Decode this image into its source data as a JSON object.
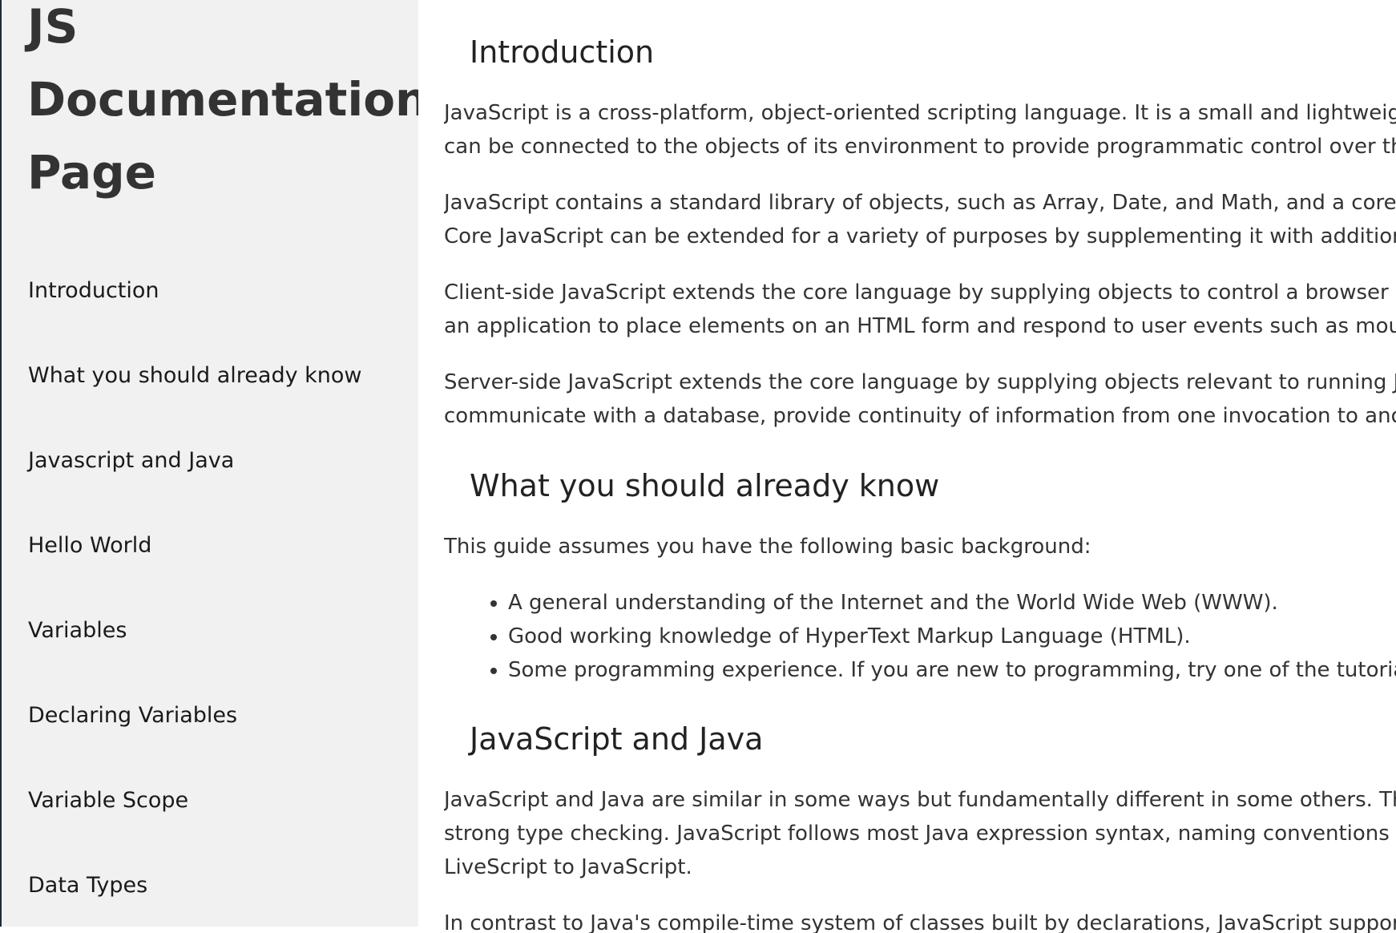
{
  "nav": {
    "title": "JS Documentation Page",
    "items": [
      "Introduction",
      "What you should already know",
      "Javascript and Java",
      "Hello World",
      "Variables",
      "Declaring Variables",
      "Variable Scope",
      "Data Types"
    ]
  },
  "main": {
    "intro": {
      "heading": "Introduction",
      "paragraphs": [
        "JavaScript is a cross-platform, object-oriented scripting language. It is a small and lightweig",
        "can be connected to the objects of its environment to provide programmatic control over the",
        "JavaScript contains a standard library of objects, such as Array, Date, and Math, and a core s",
        "Core JavaScript can be extended for a variety of purposes by supplementing it with additiona",
        "Client-side JavaScript extends the core language by supplying objects to control a browser a",
        "an application to place elements on an HTML form and respond to user events such as mous",
        "Server-side JavaScript extends the core language by supplying objects relevant to running J",
        "communicate with a database, provide continuity of information from one invocation to anoth"
      ]
    },
    "know": {
      "heading": "What you should already know",
      "lead": "This guide assumes you have the following basic background:",
      "bullets": [
        "A general understanding of the Internet and the World Wide Web (WWW).",
        "Good working knowledge of HyperText Markup Language (HTML).",
        "Some programming experience. If you are new to programming, try one of the tutorials"
      ]
    },
    "java": {
      "heading": "JavaScript and Java",
      "lines": [
        "JavaScript and Java are similar in some ways but fundamentally different in some others. The",
        "strong type checking. JavaScript follows most Java expression syntax, naming conventions a",
        "LiveScript to JavaScript.",
        "In contrast to Java's compile-time system of classes built by declarations, JavaScript suppor"
      ]
    }
  }
}
